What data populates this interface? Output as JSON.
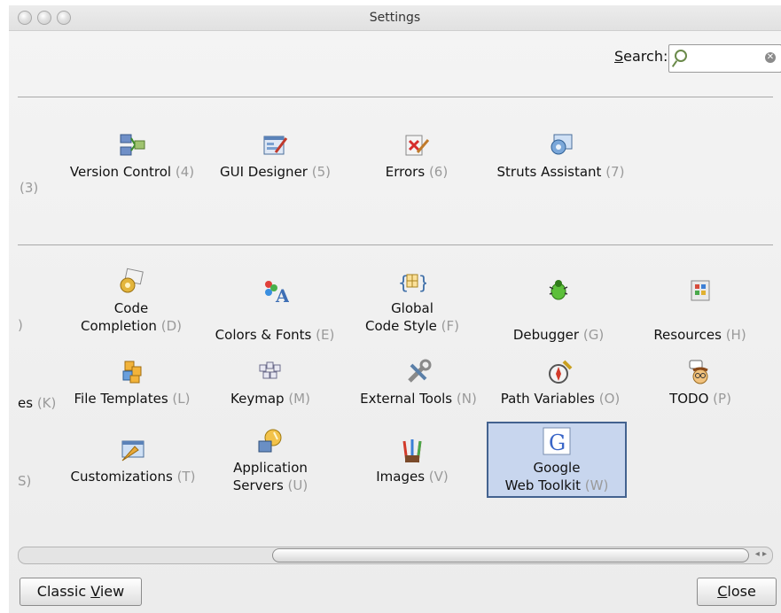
{
  "window": {
    "title": "Settings"
  },
  "search": {
    "label_prefix": "",
    "label_underlined": "S",
    "label_rest": "earch:",
    "value": ""
  },
  "row1": [
    {
      "label": "Version Control",
      "shortcut": "(4)",
      "icon": "version-control-icon"
    },
    {
      "label": "GUI Designer",
      "shortcut": "(5)",
      "icon": "gui-designer-icon"
    },
    {
      "label": "Errors",
      "shortcut": "(6)",
      "icon": "errors-icon"
    },
    {
      "label": "Struts Assistant",
      "shortcut": "(7)",
      "icon": "struts-assistant-icon"
    }
  ],
  "row1_cut": {
    "shortcut": "(3)"
  },
  "grid": [
    {
      "line1": "Code",
      "line2": "Completion",
      "shortcut": "(D)",
      "icon": "code-completion-icon"
    },
    {
      "line1": "",
      "line2": "Colors & Fonts",
      "shortcut": "(E)",
      "icon": "colors-fonts-icon"
    },
    {
      "line1": "Global",
      "line2": "Code Style",
      "shortcut": "(F)",
      "icon": "global-code-style-icon"
    },
    {
      "line1": "",
      "line2": "Debugger",
      "shortcut": "(G)",
      "icon": "debugger-icon"
    },
    {
      "line1": "",
      "line2": "Resources",
      "shortcut": "(H)",
      "icon": "resources-icon"
    },
    {
      "line1": "",
      "line2": "File Templates",
      "shortcut": "(L)",
      "icon": "file-templates-icon"
    },
    {
      "line1": "",
      "line2": "Keymap",
      "shortcut": "(M)",
      "icon": "keymap-icon"
    },
    {
      "line1": "",
      "line2": "External Tools",
      "shortcut": "(N)",
      "icon": "external-tools-icon"
    },
    {
      "line1": "",
      "line2": "Path Variables",
      "shortcut": "(O)",
      "icon": "path-variables-icon"
    },
    {
      "line1": "",
      "line2": "TODO",
      "shortcut": "(P)",
      "icon": "todo-icon"
    },
    {
      "line1": "",
      "line2": "Customizations",
      "shortcut": "(T)",
      "icon": "customizations-icon"
    },
    {
      "line1": "Application",
      "line2": "Servers",
      "shortcut": "(U)",
      "icon": "application-servers-icon"
    },
    {
      "line1": "",
      "line2": "Images",
      "shortcut": "(V)",
      "icon": "images-icon"
    },
    {
      "line1": "Google",
      "line2": "Web Toolkit",
      "shortcut": "(W)",
      "icon": "google-web-toolkit-icon"
    }
  ],
  "cut_left": [
    {
      "text": ")"
    },
    {
      "text": "es",
      "shortcut": "(K)"
    },
    {
      "text": "S)"
    }
  ],
  "buttons": {
    "classic_pre": "Classic ",
    "classic_u": "V",
    "classic_post": "iew",
    "close_u": "C",
    "close_post": "lose"
  },
  "colors": {
    "selection": "#c8d6ee",
    "selection_border": "#43628f"
  }
}
